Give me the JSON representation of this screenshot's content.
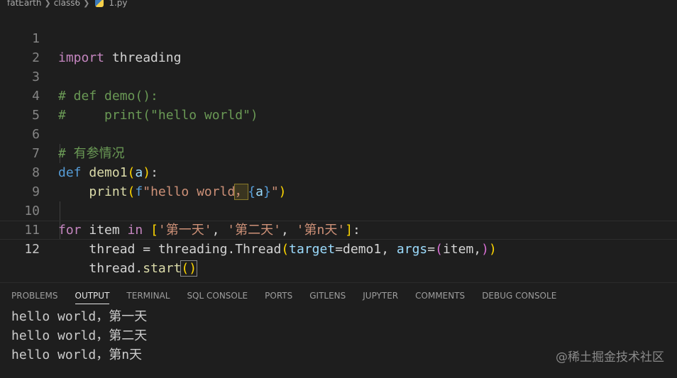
{
  "breadcrumb": {
    "folder1": "fatEarth",
    "folder2": "class6",
    "file": "1.py"
  },
  "editor": {
    "lines": [
      {
        "n": "1"
      },
      {
        "n": "2"
      },
      {
        "n": "3"
      },
      {
        "n": "4"
      },
      {
        "n": "5"
      },
      {
        "n": "6"
      },
      {
        "n": "7"
      },
      {
        "n": "8"
      },
      {
        "n": "9"
      },
      {
        "n": "10"
      },
      {
        "n": "11"
      },
      {
        "n": "12"
      }
    ],
    "code": {
      "l1_kw": "import",
      "l1_mod": " threading",
      "l3": "# def demo():",
      "l4": "#     print(\"hello world\")",
      "l6": "# 有参情况",
      "l7_kw": "def",
      "l7_fn": "demo1",
      "l7_p1": "(",
      "l7_param": "a",
      "l7_p2": ")",
      "l7_colon": ":",
      "l8_fn": "print",
      "l8_p1": "(",
      "l8_f": "f",
      "l8_s1": "\"hello world",
      "l8_comma": "，",
      "l8_b1": "{",
      "l8_var": "a",
      "l8_b2": "}",
      "l8_s2": "\"",
      "l8_p2": ")",
      "l10_for": "for",
      "l10_item": " item ",
      "l10_in": "in",
      "l10_sp": " ",
      "l10_b1": "[",
      "l10_s1": "'第一天'",
      "l10_c1": ", ",
      "l10_s2": "'第二天'",
      "l10_c2": ", ",
      "l10_s3": "'第n天'",
      "l10_b2": "]",
      "l10_colon": ":",
      "l11_thread": "thread",
      "l11_eq": " = ",
      "l11_mod": "threading",
      "l11_dot": ".",
      "l11_cls": "Thread",
      "l11_p1": "(",
      "l11_target": "target",
      "l11_eq2": "=demo1, ",
      "l11_args": "args",
      "l11_eq3": "=",
      "l11_p2": "(",
      "l11_item": "item,",
      "l11_p3": ")",
      "l11_p4": ")",
      "l12_thread": "thread",
      "l12_dot": ".",
      "l12_fn": "start",
      "l12_p": "()"
    }
  },
  "panel": {
    "tabs": [
      "PROBLEMS",
      "OUTPUT",
      "TERMINAL",
      "SQL CONSOLE",
      "PORTS",
      "GITLENS",
      "JUPYTER",
      "COMMENTS",
      "DEBUG CONSOLE"
    ],
    "active_tab": "OUTPUT",
    "output_lines": [
      "hello world，第一天",
      "hello world，第二天",
      "hello world，第n天"
    ]
  },
  "watermark": "@稀土掘金技术社区"
}
